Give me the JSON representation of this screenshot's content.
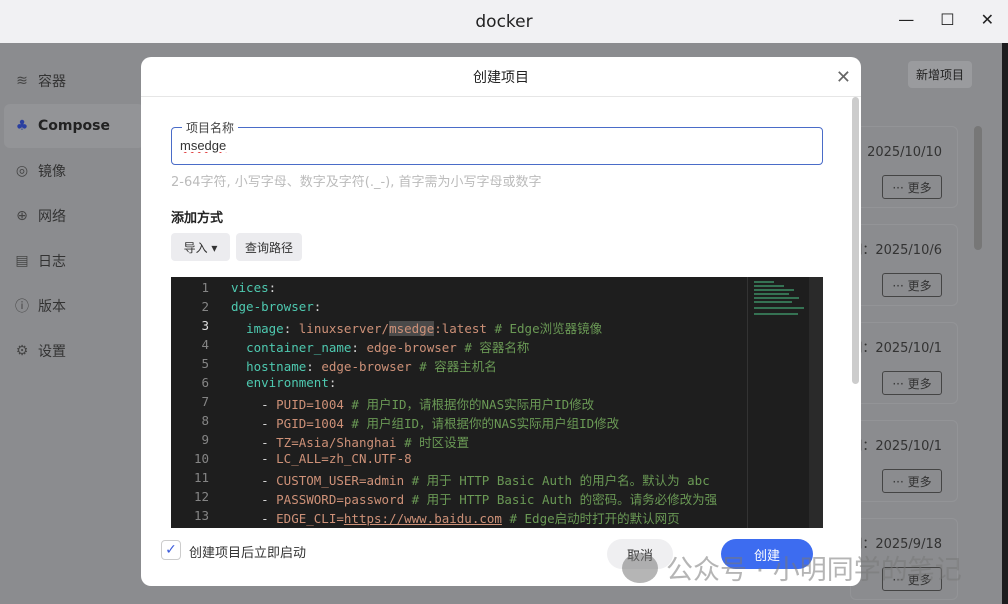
{
  "window": {
    "title": "docker",
    "minimize": "—",
    "maximize": "☐",
    "close": "✕"
  },
  "sidebar": {
    "items": [
      {
        "label": "容器",
        "icon": "layers-icon",
        "glyph": "≋"
      },
      {
        "label": "Compose",
        "icon": "compose-icon",
        "glyph": "♣"
      },
      {
        "label": "镜像",
        "icon": "disc-icon",
        "glyph": "◎"
      },
      {
        "label": "网络",
        "icon": "globe-icon",
        "glyph": "⊕"
      },
      {
        "label": "日志",
        "icon": "log-icon",
        "glyph": "▤"
      },
      {
        "label": "版本",
        "icon": "info-icon",
        "glyph": "ⓘ"
      },
      {
        "label": "设置",
        "icon": "gear-icon",
        "glyph": "⚙"
      }
    ]
  },
  "main": {
    "new_project": "新增项目",
    "more_label": "··· 更多",
    "cards": [
      {
        "date": "间：2025/10/10"
      },
      {
        "date": "间：2025/10/6"
      },
      {
        "date": "间：2025/10/1"
      },
      {
        "date": "间：2025/10/1"
      },
      {
        "date": "间：2025/9/18"
      }
    ]
  },
  "dialog": {
    "title": "创建项目",
    "close": "✕",
    "name_label": "项目名称",
    "name_value": "msedge",
    "hint": "2-64字符, 小写字母、数字及字符(._-), 首字需为小写字母或数字",
    "add_method_label": "添加方式",
    "import_label": "导入 ▾",
    "query_path_label": "查询路径",
    "code_lines": [
      {
        "n": "1",
        "parts": [
          [
            "k",
            "vices"
          ],
          [
            "",
            ":"
          ]
        ]
      },
      {
        "n": "2",
        "parts": [
          [
            "k",
            "dge-browser"
          ],
          [
            "",
            ":"
          ]
        ]
      },
      {
        "n": "3",
        "parts": [
          [
            "",
            "  "
          ],
          [
            "k",
            "image"
          ],
          [
            "",
            ": "
          ],
          [
            "v",
            "linuxserver/"
          ],
          [
            "v hl",
            "msedge"
          ],
          [
            "v",
            ":latest "
          ],
          [
            "c",
            "# Edge浏览器镜像"
          ]
        ]
      },
      {
        "n": "4",
        "parts": [
          [
            "",
            "  "
          ],
          [
            "k",
            "container_name"
          ],
          [
            "",
            ": "
          ],
          [
            "v",
            "edge-browser "
          ],
          [
            "c",
            "# 容器名称"
          ]
        ]
      },
      {
        "n": "5",
        "parts": [
          [
            "",
            "  "
          ],
          [
            "k",
            "hostname"
          ],
          [
            "",
            ": "
          ],
          [
            "v",
            "edge-browser "
          ],
          [
            "c",
            "# 容器主机名"
          ]
        ]
      },
      {
        "n": "6",
        "parts": [
          [
            "",
            "  "
          ],
          [
            "k",
            "environment"
          ],
          [
            "",
            ":"
          ]
        ]
      },
      {
        "n": "7",
        "parts": [
          [
            "",
            "    - "
          ],
          [
            "v",
            "PUID=1004 "
          ],
          [
            "c",
            "# 用户ID，请根据你的NAS实际用户ID修改"
          ]
        ]
      },
      {
        "n": "8",
        "parts": [
          [
            "",
            "    - "
          ],
          [
            "v",
            "PGID=1004 "
          ],
          [
            "c",
            "# 用户组ID，请根据你的NAS实际用户组ID修改"
          ]
        ]
      },
      {
        "n": "9",
        "parts": [
          [
            "",
            "    - "
          ],
          [
            "v",
            "TZ=Asia/Shanghai "
          ],
          [
            "c",
            "# 时区设置"
          ]
        ]
      },
      {
        "n": "10",
        "parts": [
          [
            "",
            "    - "
          ],
          [
            "v",
            "LC_ALL=zh_CN.UTF-8"
          ]
        ]
      },
      {
        "n": "11",
        "parts": [
          [
            "",
            "    - "
          ],
          [
            "v",
            "CUSTOM_USER=admin "
          ],
          [
            "c",
            "# 用于 HTTP Basic Auth 的用户名。默认为 abc"
          ]
        ]
      },
      {
        "n": "12",
        "parts": [
          [
            "",
            "    - "
          ],
          [
            "v",
            "PASSWORD=password "
          ],
          [
            "c",
            "# 用于 HTTP Basic Auth 的密码。请务必修改为强"
          ]
        ]
      },
      {
        "n": "13",
        "parts": [
          [
            "",
            "    - "
          ],
          [
            "v",
            "EDGE_CLI="
          ],
          [
            "v u",
            "https://www.baidu.com"
          ],
          [
            "c",
            " # Edge启动时打开的默认网页"
          ]
        ]
      }
    ],
    "autostart_label": "创建项目后立即启动",
    "autostart_checked": true,
    "cancel_label": "取消",
    "create_label": "创建"
  },
  "watermark": "公众号 · 小明同学的笔记"
}
